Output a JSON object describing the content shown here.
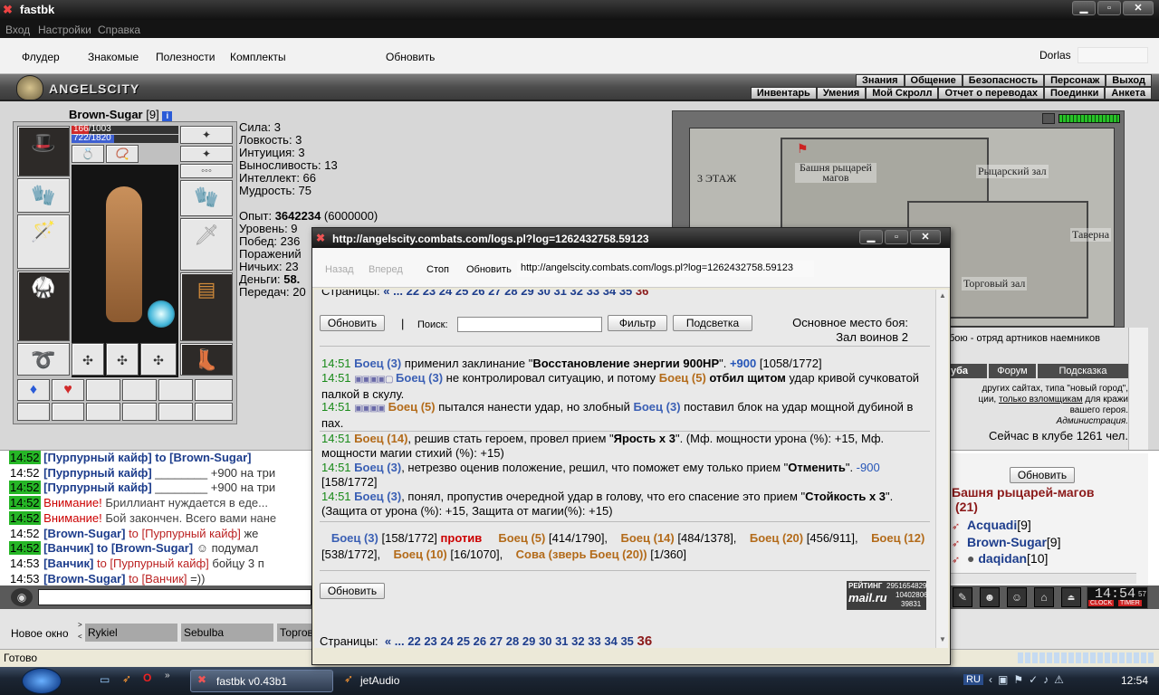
{
  "window": {
    "title": "fastbk"
  },
  "menu": [
    "Вход",
    "Настройки",
    "Справка"
  ],
  "toolbar": {
    "items": [
      "Флудер",
      "Знакомые",
      "Полезности",
      "Комплекты"
    ],
    "refresh": "Обновить",
    "login": "Dorlas"
  },
  "game": {
    "logo": "ANGELSCITY",
    "nav_top": [
      "Знания",
      "Общение",
      "Безопасность",
      "Персонаж",
      "Выход"
    ],
    "nav_bottom": [
      "Инвентарь",
      "Умения",
      "Мой Скролл",
      "Отчет о переводах",
      "Поединки",
      "Анкета"
    ]
  },
  "character": {
    "name": "Brown-Sugar",
    "level": "[9]",
    "hp": "166/1003",
    "mana": "722/1820",
    "stats": [
      "Сила: 3",
      "Ловкость: 3",
      "Интуиция: 3",
      "Выносливость: 13",
      "Интеллект: 66",
      "Мудрость: 75"
    ],
    "exp_label": "Опыт: ",
    "exp_value": "3642234",
    "exp_next": " (6000000)",
    "info": [
      "Уровень: 9",
      "Побед: 236",
      "Поражений",
      "Ничьих: 23"
    ],
    "money_label": "Деньги: ",
    "money_value": "58.",
    "transfers": "Передач: 20"
  },
  "map": {
    "labels": [
      "3 ЭТАЖ",
      "Башня рыцарей магов",
      "Рыцарский зал",
      "Таверна",
      "Торговый зал"
    ]
  },
  "right_panel": {
    "caption": "бою - отряд артников наемников",
    "tabs": [
      "уба",
      "Форум",
      "Подсказка"
    ],
    "notice1": "других сайтах, типа \"новый город\",",
    "notice2a": "ции, ",
    "notice2b": "только взломщикам",
    "notice2c": " для кражи",
    "notice3": "вашего героя.",
    "admin": "Администрация.",
    "online": "Сейчас в клубе 1261 чел.",
    "refresh": "Обновить",
    "room": "Башня рыцарей-магов",
    "room_count": "(21)",
    "players": [
      {
        "name": "Acquadi",
        "lvl": "[9]"
      },
      {
        "name": "Brown-Sugar",
        "lvl": "[9]"
      },
      {
        "name": "daqidan",
        "lvl": "[10]"
      }
    ]
  },
  "chat": [
    {
      "t": "14:52",
      "g": true,
      "a": "[Пурпурный кайф]",
      "b": " to [Brown-Sugar]",
      "c": ""
    },
    {
      "t": "14:52",
      "g": false,
      "a": "[Пурпурный кайф]",
      "b": "",
      "c": " ________ +900 на три"
    },
    {
      "t": "14:52",
      "g": true,
      "a": "[Пурпурный кайф]",
      "b": "",
      "c": " ________ +900 на три"
    },
    {
      "t": "14:52",
      "g": true,
      "a": "",
      "b": "",
      "c": "",
      "warn": "Внимание!",
      "w2": " Бриллиант нуждается в еде..."
    },
    {
      "t": "14:52",
      "g": true,
      "a": "",
      "b": "",
      "c": "",
      "warn": "Внимание!",
      "w2": " Бой закончен. Всего вами нане"
    },
    {
      "t": "14:52",
      "g": false,
      "a": "[Brown-Sugar]",
      "b": " to [Пурпурный кайф]",
      "c": " же"
    },
    {
      "t": "14:52",
      "g": true,
      "a": "[Ванчик]",
      "b": " to [Brown-Sugar]",
      "c": " ☺ подумал"
    },
    {
      "t": "14:53",
      "g": false,
      "a": "[Ванчик]",
      "b": " to [Пурпурный кайф]",
      "c": " бойцу 3 п"
    },
    {
      "t": "14:53",
      "g": false,
      "a": "[Brown-Sugar]",
      "b": " to [Ванчик]",
      "c": " =))"
    }
  ],
  "clock": {
    "time": "14:54",
    "sec": "57",
    "label1": "CLOCK",
    "label2": "TIMER"
  },
  "bottom": {
    "new_window": "Новое окно",
    "tabs": [
      "Rykiel",
      "Sebulba",
      "Торгов"
    ]
  },
  "status": "Готово",
  "taskbar": {
    "items": [
      "fastbk v0.43b1",
      "jetAudio"
    ],
    "lang": "RU",
    "time": "12:54"
  },
  "popup": {
    "title": "http://angelscity.combats.com/logs.pl?log=1262432758.59123",
    "back": "Назад",
    "forward": "Вперед",
    "stop": "Стоп",
    "refresh": "Обновить",
    "url": "http://angelscity.combats.com/logs.pl?log=1262432758.59123",
    "pages_label": "Страницы:",
    "pages": [
      "«",
      "...",
      "22",
      "23",
      "24",
      "25",
      "26",
      "27",
      "28",
      "29",
      "30",
      "31",
      "32",
      "33",
      "34",
      "35"
    ],
    "current_page": "36",
    "btn_refresh": "Обновить",
    "search_label": "Поиск:",
    "search_value": "",
    "btn_filter": "Фильтр",
    "btn_highlight": "Подсветка",
    "place1": "Основное место боя:",
    "place2": "Зал воинов 2",
    "rating": "РЕЙТИНГ",
    "mail": "mail.ru",
    "r1": "2951654829",
    "r2": "10402806",
    "r3": "39831",
    "log": {
      "l1": {
        "t": "14:51",
        "a": "Боец (3)",
        "b": " применил заклинание \"",
        "c": "Восстановление энергии 900HP",
        "d": "\". ",
        "e": "+900",
        "f": " [1058/1772]"
      },
      "l2": {
        "t": "14:51",
        "a": "Боец (3)",
        "b": " не контролировал ситуацию, и потому ",
        "c": "Боец (5)",
        "d": " ",
        "e": "отбил щитом",
        "f": " удар кривой сучковатой палкой в скулу."
      },
      "l3": {
        "t": "14:51",
        "a": "Боец (5)",
        "b": " пытался нанести удар, но злобный ",
        "c": "Боец (3)",
        "d": " поставил блок на удар мощной дубиной в пах."
      },
      "l4": {
        "t": "14:51",
        "a": "Боец (14)",
        "b": ", решив стать героем, провел прием \"",
        "c": "Ярость x 3",
        "d": "\". (Мф. мощности урона (%): +15, Мф. мощности магии стихий (%): +15)"
      },
      "l5": {
        "t": "14:51",
        "a": "Боец (3)",
        "b": ", нетрезво оценив положение, решил, что поможет ему только прием \"",
        "c": "Отменить",
        "d": "\". ",
        "e": "-900",
        "f": " [158/1772]"
      },
      "l6": {
        "t": "14:51",
        "a": "Боец (3)",
        "b": ", понял, пропустив очередной удар в голову, что его спасение это прием \"",
        "c": "Стойкость x 3",
        "d": "\". (Защита от урона (%): +15, Защита от магии(%): +15)"
      }
    },
    "summary": {
      "p1": "Боец (3)",
      "h1": " [158/1772] ",
      "vs": "против",
      "p2": "Боец (5)",
      "h2": " [414/1790], ",
      "p3": "Боец (14)",
      "h3": " [484/1378], ",
      "p4": "Боец (20)",
      "h4": "[456/911], ",
      "p5": "Боец (12)",
      "h5": " [538/1772], ",
      "p6": "Боец (10)",
      "h6": " [16/1070], ",
      "p7": "Сова (зверь Боец (20))",
      "h7": " [1/360]"
    }
  }
}
